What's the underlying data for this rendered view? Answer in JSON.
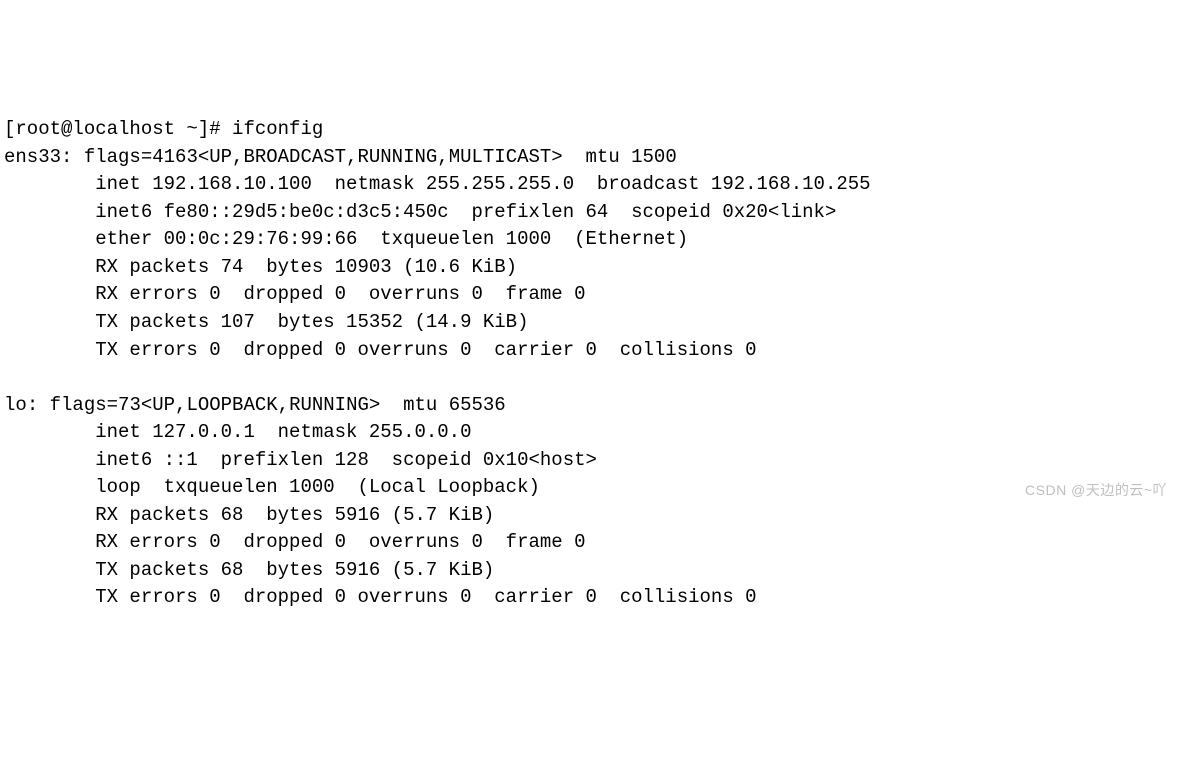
{
  "prompt": "[root@localhost ~]# ",
  "command": "ifconfig",
  "iface1": {
    "name": "ens33",
    "flags_line": "flags=4163<UP,BROADCAST,RUNNING,MULTICAST>  mtu 1500",
    "inet_line": "inet 192.168.10.100  netmask 255.255.255.0  broadcast 192.168.10.255",
    "inet6_line": "inet6 fe80::29d5:be0c:d3c5:450c  prefixlen 64  scopeid 0x20<link>",
    "ether_line": "ether 00:0c:29:76:99:66  txqueuelen 1000  (Ethernet)",
    "rx_packets_line": "RX packets 74  bytes 10903 (10.6 KiB)",
    "rx_errors_line": "RX errors 0  dropped 0  overruns 0  frame 0",
    "tx_packets_line": "TX packets 107  bytes 15352 (14.9 KiB)",
    "tx_errors_line": "TX errors 0  dropped 0 overruns 0  carrier 0  collisions 0"
  },
  "iface2": {
    "name": "lo",
    "flags_line": "flags=73<UP,LOOPBACK,RUNNING>  mtu 65536",
    "inet_line": "inet 127.0.0.1  netmask 255.0.0.0",
    "inet6_line": "inet6 ::1  prefixlen 128  scopeid 0x10<host>",
    "loop_line": "loop  txqueuelen 1000  (Local Loopback)",
    "rx_packets_line": "RX packets 68  bytes 5916 (5.7 KiB)",
    "rx_errors_line": "RX errors 0  dropped 0  overruns 0  frame 0",
    "tx_packets_line": "TX packets 68  bytes 5916 (5.7 KiB)",
    "tx_errors_line": "TX errors 0  dropped 0 overruns 0  carrier 0  collisions 0"
  },
  "watermark": "CSDN @天边的云~吖"
}
